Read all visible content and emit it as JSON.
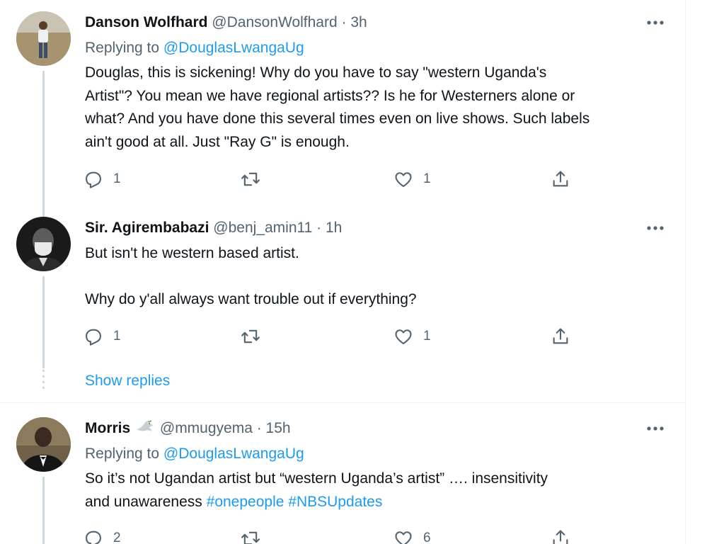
{
  "tweets": [
    {
      "name": "Danson Wolfhard",
      "handle": "@DansonWolfhard",
      "time": "· 3h",
      "replying_label": "Replying to",
      "replying_to": "@DouglasLwangaUg",
      "text_lines": [
        "Douglas, this is sickening! Why do you have to say \"western Uganda's",
        "Artist\"? You mean we have regional artists?? Is he for Westerners alone or",
        "what? And you have done this several times even on live shows. Such labels",
        "ain't good at all. Just \"Ray G\" is enough."
      ],
      "reply_count": "1",
      "like_count": "1"
    },
    {
      "name": "Sir. Agirembabazi",
      "handle": "@benj_amin11",
      "time": "· 1h",
      "text_lines": [
        "But isn't he western based artist.",
        "",
        "Why do y'all always want trouble out if everything?"
      ],
      "reply_count": "1",
      "like_count": "1"
    },
    {
      "name": "Morris",
      "handle": "@mmugyema",
      "time": "· 15h",
      "replying_label": "Replying to",
      "replying_to": "@DouglasLwangaUg",
      "text_line1": "So it’s not Ugandan artist but “western Uganda’s artist” …. insensitivity",
      "text_line2_prefix": "and unawareness",
      "hashtag1": "#onepeople",
      "hashtag2": "#NBSUpdates",
      "reply_count": "2",
      "like_count": "6"
    }
  ],
  "show_replies": "Show replies",
  "icons": {
    "reply": "reply-icon",
    "retweet": "retweet-icon",
    "like": "like-icon",
    "share": "share-icon",
    "more": "more-icon",
    "dove": "dove-emoji-icon"
  },
  "colors": {
    "accent": "#1d9bf0",
    "text": "#0f1419",
    "muted": "#536471",
    "thread_line": "#cfd9de",
    "separator": "#eff3f4"
  }
}
